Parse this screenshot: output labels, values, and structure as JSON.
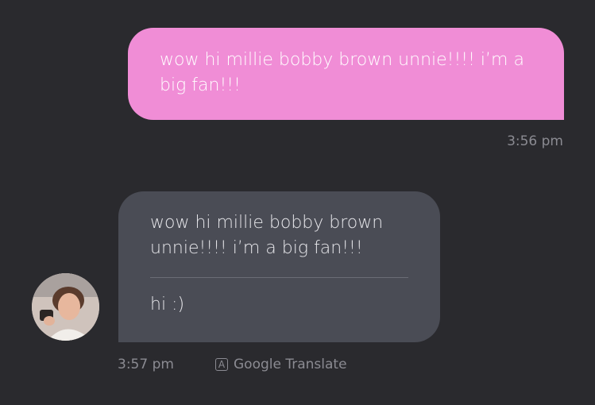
{
  "sent_message": {
    "text": "wow hi millie bobby brown unnie!!!! i’m a big fan!!!",
    "time": "3:56 pm"
  },
  "received_message": {
    "original": "wow hi millie bobby brown unnie!!!! i’m a big fan!!!",
    "translation": "hi :)",
    "time": "3:57 pm"
  },
  "translate": {
    "icon_glyph": "A",
    "label": "Google Translate"
  },
  "colors": {
    "background": "#2a2a2e",
    "sent_bubble": "#f08dd6",
    "received_bubble": "#4a4c55",
    "meta_text": "#8b8b92"
  }
}
